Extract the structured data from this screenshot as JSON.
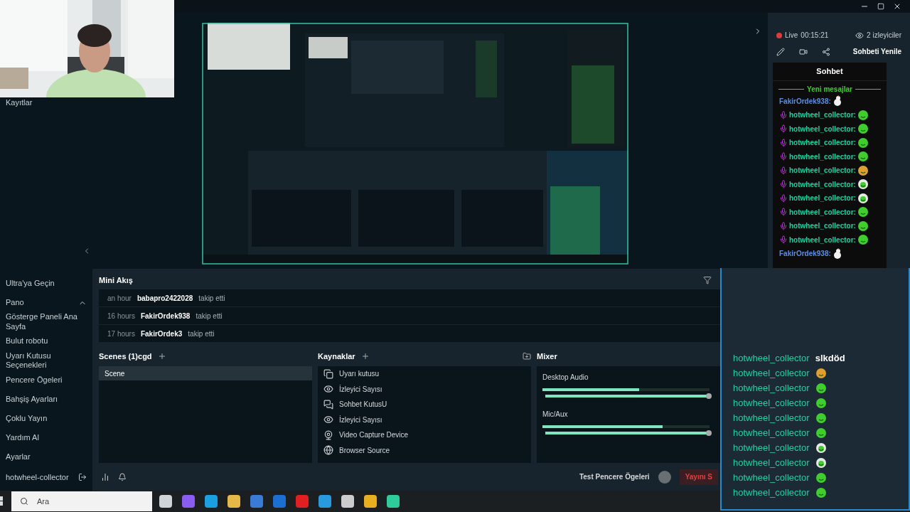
{
  "sidebar": {
    "top_item": "Kayıtlar",
    "items": [
      {
        "label": "Ultra'ya Geçin",
        "kind": "section"
      },
      {
        "label": "Pano",
        "kind": "section",
        "expanded": true,
        "children": [
          {
            "label": "Gösterge Paneli Ana Sayfa"
          },
          {
            "label": "Bulut robotu"
          },
          {
            "label": "Uyarı Kutusu Seçenekleri"
          },
          {
            "label": "Pencere Ögeleri"
          },
          {
            "label": "Bahşiş Ayarları"
          },
          {
            "label": "Çoklu Yayın"
          }
        ]
      },
      {
        "label": "Yardım Al",
        "kind": "section"
      },
      {
        "label": "Ayarlar",
        "kind": "settings"
      }
    ],
    "user": "hotwheel-collector"
  },
  "chat_panel": {
    "live": "Live",
    "timer": "00:15:21",
    "viewers": "2 izleyiciler",
    "refresh": "Sohbeti Yenile",
    "title": "Sohbet",
    "divider": "Yeni mesajlar",
    "messages": [
      {
        "user": "FakirOrdek938:",
        "color": "#5b8ee0",
        "badge": false,
        "kind": "chicken"
      },
      {
        "user": "hotwheel_collector:",
        "color": "#1fd1a0",
        "badge": true,
        "kind": "green"
      },
      {
        "user": "hotwheel_collector:",
        "color": "#1fd1a0",
        "badge": true,
        "kind": "green"
      },
      {
        "user": "hotwheel_collector:",
        "color": "#1fd1a0",
        "badge": true,
        "kind": "green"
      },
      {
        "user": "hotwheel_collector:",
        "color": "#1fd1a0",
        "badge": true,
        "kind": "green"
      },
      {
        "user": "hotwheel_collector:",
        "color": "#1fd1a0",
        "badge": true,
        "kind": "orange"
      },
      {
        "user": "hotwheel_collector:",
        "color": "#1fd1a0",
        "badge": true,
        "kind": "white"
      },
      {
        "user": "hotwheel_collector:",
        "color": "#1fd1a0",
        "badge": true,
        "kind": "white"
      },
      {
        "user": "hotwheel_collector:",
        "color": "#1fd1a0",
        "badge": true,
        "kind": "green"
      },
      {
        "user": "hotwheel_collector:",
        "color": "#1fd1a0",
        "badge": true,
        "kind": "green"
      },
      {
        "user": "hotwheel_collector:",
        "color": "#1fd1a0",
        "badge": true,
        "kind": "green"
      },
      {
        "user": "FakirOrdek938:",
        "color": "#5b8ee0",
        "badge": false,
        "kind": "chicken"
      }
    ]
  },
  "mini_feed": {
    "title": "Mini Akış",
    "events": [
      {
        "time": "an hour",
        "user": "babapro2422028",
        "action": "takip etti"
      },
      {
        "time": "16 hours",
        "user": "FakirOrdek938",
        "action": "takip etti"
      },
      {
        "time": "17 hours",
        "user": "FakirOrdek3",
        "action": "takip etti"
      }
    ]
  },
  "scenes": {
    "title": "Scenes (1)cgd",
    "items": [
      {
        "label": "Scene",
        "selected": true
      }
    ]
  },
  "sources": {
    "title": "Kaynaklar",
    "items": [
      {
        "label": "Uyarı kutusu",
        "kind": "widget"
      },
      {
        "label": "İzleyici Sayısı",
        "kind": "eye"
      },
      {
        "label": "Sohbet KutusU",
        "kind": "chat"
      },
      {
        "label": "İzleyici Sayısı",
        "kind": "eye"
      },
      {
        "label": "Video Capture Device",
        "kind": "webcam"
      },
      {
        "label": "Browser Source",
        "kind": "globe"
      }
    ]
  },
  "mixer": {
    "title": "Mixer",
    "channels": [
      {
        "name": "Desktop Audio",
        "meter": {
          "level": 0.58
        },
        "level": 1
      },
      {
        "name": "Mic/Aux",
        "meter": {
          "level": 0.72
        },
        "level": 1
      }
    ]
  },
  "bottom_bar": {
    "test_label": "Test Pencere Ögeleri",
    "go_live": "Yayını S"
  },
  "overlay_chat": {
    "messages": [
      {
        "user": "hotwheel_collector",
        "kind": "text",
        "text": "slkdöd"
      },
      {
        "user": "hotwheel_collector",
        "kind": "orange"
      },
      {
        "user": "hotwheel_collector",
        "kind": "green"
      },
      {
        "user": "hotwheel_collector",
        "kind": "green"
      },
      {
        "user": "hotwheel_collector",
        "kind": "green"
      },
      {
        "user": "hotwheel_collector",
        "kind": "green"
      },
      {
        "user": "hotwheel_collector",
        "kind": "white"
      },
      {
        "user": "hotwheel_collector",
        "kind": "white"
      },
      {
        "user": "hotwheel_collector",
        "kind": "green"
      },
      {
        "user": "hotwheel_collector",
        "kind": "green"
      }
    ]
  },
  "taskbar": {
    "search": {
      "placeholder": "Ara"
    }
  }
}
